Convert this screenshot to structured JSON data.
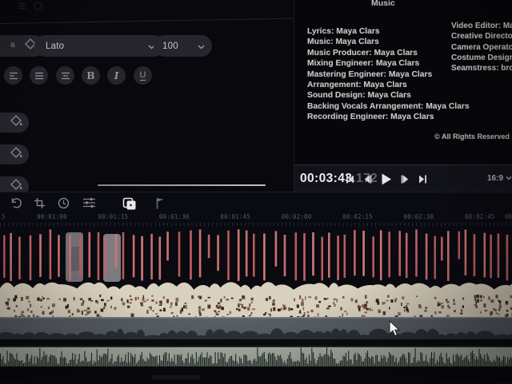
{
  "left_panel": {
    "font_dropdown": {
      "value": "Lato"
    },
    "size_dropdown": {
      "value": "100"
    },
    "format_buttons": {
      "bold": "B",
      "italic": "I",
      "underline": "U"
    },
    "align_icons": [
      "align-left",
      "align-justify",
      "align-center"
    ],
    "side_tool_icons": [
      "fill-bucket",
      "fill-bucket",
      "fill-bucket"
    ]
  },
  "preview": {
    "title": "Music",
    "credits_left": [
      "Lyrics: Maya Clars",
      "Music: Maya Clars",
      "Music Producer: Maya Clars",
      "Mixing Engineer: Maya Clars",
      "Mastering Engineer: Maya Clars",
      "Arrangement: Maya Clars",
      "Sound Design: Maya Clars",
      "Backing Vocals Arrangement: Maya Clars",
      "Recording Engineer: Maya Clars"
    ],
    "credits_right": [
      "Video Editor: Maya C",
      "Creative Directors: M",
      "Camera Operators: B",
      "Costume Designer: B",
      "Seamstress: bronny"
    ],
    "copyright": "© All Rights Reserved"
  },
  "playback": {
    "timecode": "00:03:43",
    "timecode_ms": ".172",
    "controls": [
      "skip-start",
      "step-back",
      "play",
      "step-forward",
      "skip-end"
    ],
    "aspect_ratio": "16:9"
  },
  "timeline": {
    "toolbar_icons": [
      "undo",
      "crop",
      "clock",
      "adjust",
      "overlay-frames",
      "flag"
    ],
    "active_tool": "overlay-frames",
    "ruler": {
      "partial_left": "5",
      "labels": [
        "00:01:00",
        "00:01:15",
        "00:01:30",
        "00:01:45",
        "00:02:00",
        "00:02:15",
        "00:02:30",
        "00:02:45"
      ],
      "partial_right": "00:"
    },
    "colors": {
      "text_clip_red": "#c96f6f",
      "video_track_beige": "#d9d1bf",
      "video_track_brown": "#6b4c38",
      "gray_track": "#585e66",
      "audio_track_bg": "#a9b2a6",
      "audio_waveform": "#222c24"
    }
  }
}
